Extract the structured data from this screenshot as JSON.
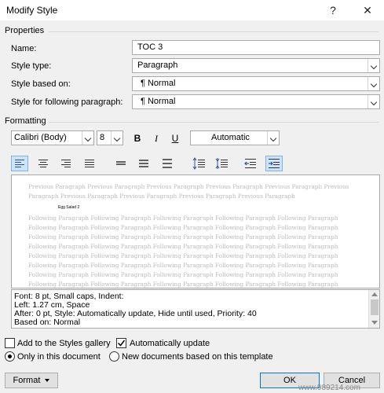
{
  "dialog": {
    "title": "Modify Style",
    "help_glyph": "?",
    "close_glyph": "✕"
  },
  "properties": {
    "heading": "Properties",
    "name_label": "Name:",
    "name_value": "TOC 3",
    "style_type_label": "Style type:",
    "style_type_value": "Paragraph",
    "based_on_label": "Style based on:",
    "based_on_value": "¶ Normal",
    "following_label": "Style for following paragraph:",
    "following_value": "¶ Normal"
  },
  "formatting": {
    "heading": "Formatting",
    "font": "Calibri (Body)",
    "size": "8",
    "bold": "B",
    "italic": "I",
    "underline": "U",
    "color": "Automatic"
  },
  "preview": {
    "previous": [
      "Previous Paragraph Previous Paragraph Previous Paragraph Previous Paragraph Previous Paragraph Previous",
      "Paragraph Previous Paragraph Previous Paragraph Previous Paragraph Previous Paragraph"
    ],
    "sample": "Egg Salad   2",
    "following": [
      "Following Paragraph Following Paragraph Following Paragraph Following Paragraph Following Paragraph",
      "Following Paragraph Following Paragraph Following Paragraph Following Paragraph Following Paragraph",
      "Following Paragraph Following Paragraph Following Paragraph Following Paragraph Following Paragraph",
      "Following Paragraph Following Paragraph Following Paragraph Following Paragraph Following Paragraph",
      "Following Paragraph Following Paragraph Following Paragraph Following Paragraph Following Paragraph",
      "Following Paragraph Following Paragraph Following Paragraph Following Paragraph Following Paragraph",
      "Following Paragraph Following Paragraph Following Paragraph Following Paragraph Following Paragraph",
      "Following Paragraph Following Paragraph Following Paragraph Following Paragraph Following Paragraph"
    ]
  },
  "description": [
    "Font: 8 pt, Small caps, Indent:",
    "   Left:  1.27 cm, Space",
    "   After:  0 pt, Style: Automatically update, Hide until used, Priority: 40",
    "   Based on: Normal"
  ],
  "options": {
    "add_gallery": "Add to the Styles gallery",
    "auto_update": "Automatically update",
    "only_doc": "Only in this document",
    "new_docs": "New documents based on this template"
  },
  "buttons": {
    "format": "Format",
    "ok": "OK",
    "cancel": "Cancel"
  },
  "watermark": "www.989214.com"
}
